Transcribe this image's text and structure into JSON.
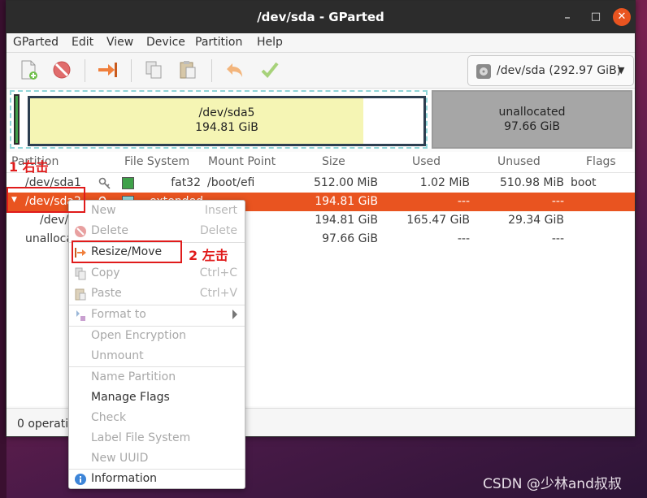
{
  "window": {
    "title": "/dev/sda - GParted",
    "controls": {
      "minimize": "–",
      "maximize": "□",
      "close": "✕"
    }
  },
  "menubar": {
    "items": [
      "GParted",
      "Edit",
      "View",
      "Device",
      "Partition",
      "Help"
    ]
  },
  "toolbar": {
    "icons": [
      "new-partition-icon",
      "delete-icon",
      "resize-move-icon",
      "copy-icon",
      "paste-icon",
      "undo-icon",
      "apply-icon"
    ],
    "device_selector": "/dev/sda (292.97 GiB)"
  },
  "disk_map": {
    "sda5": {
      "name": "/dev/sda5",
      "size": "194.81 GiB"
    },
    "unallocated": {
      "name": "unallocated",
      "size": "97.66 GiB"
    }
  },
  "table": {
    "headers": {
      "partition": "Partition",
      "file_system": "File System",
      "mount_point": "Mount Point",
      "size": "Size",
      "used": "Used",
      "unused": "Unused",
      "flags": "Flags"
    },
    "rows": [
      {
        "partition": "/dev/sda1",
        "fs": "fat32",
        "mount": "/boot/efi",
        "size": "512.00 MiB",
        "used": "1.02 MiB",
        "unused": "510.98 MiB",
        "flags": "boot",
        "fs_color": "#3fa14a"
      },
      {
        "partition": "/dev/sda2",
        "fs": "extended",
        "mount": "",
        "size": "194.81 GiB",
        "used": "---",
        "unused": "---",
        "flags": "",
        "fs_color": "#8fd5d8"
      },
      {
        "partition": "/dev/",
        "fs": "",
        "mount": "",
        "size": "194.81 GiB",
        "used": "165.47 GiB",
        "unused": "29.34 GiB",
        "flags": ""
      },
      {
        "partition": "unalloca",
        "fs": "",
        "mount": "",
        "size": "97.66 GiB",
        "used": "---",
        "unused": "---",
        "flags": ""
      }
    ]
  },
  "status": {
    "text": "0 operatio"
  },
  "context_menu": {
    "items": [
      {
        "label": "New",
        "accel": "Insert",
        "enabled": false
      },
      {
        "label": "Delete",
        "accel": "Delete",
        "enabled": false
      },
      {
        "label": "Resize/Move",
        "accel": "",
        "enabled": true
      },
      {
        "label": "Copy",
        "accel": "Ctrl+C",
        "enabled": false
      },
      {
        "label": "Paste",
        "accel": "Ctrl+V",
        "enabled": false
      },
      {
        "label": "Format to",
        "accel": "",
        "enabled": false
      },
      {
        "label": "Open Encryption",
        "accel": "",
        "enabled": false
      },
      {
        "label": "Unmount",
        "accel": "",
        "enabled": false
      },
      {
        "label": "Name Partition",
        "accel": "",
        "enabled": false
      },
      {
        "label": "Manage Flags",
        "accel": "",
        "enabled": true
      },
      {
        "label": "Check",
        "accel": "",
        "enabled": false
      },
      {
        "label": "Label File System",
        "accel": "",
        "enabled": false
      },
      {
        "label": "New UUID",
        "accel": "",
        "enabled": false
      },
      {
        "label": "Information",
        "accel": "",
        "enabled": true
      }
    ]
  },
  "annotations": {
    "step1": "1 右击",
    "step2": "2 左击"
  },
  "watermark": "CSDN @少林and叔叔",
  "colors": {
    "accent": "#e95420",
    "annotation": "#e01b1b",
    "unallocated": "#a6a6a6",
    "sda5_used": "#f5f5b4"
  }
}
